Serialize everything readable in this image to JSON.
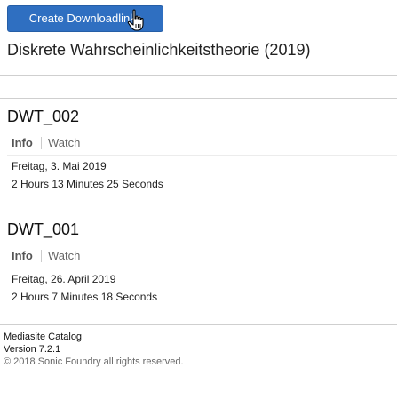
{
  "toolbar": {
    "create_downloadlinks_label": "Create Downloadlinks"
  },
  "catalog": {
    "title": "Diskrete Wahrscheinlichkeitstheorie (2019)"
  },
  "presentations": [
    {
      "title": "DWT_002",
      "tabs": {
        "info": "Info",
        "watch": "Watch"
      },
      "date": "Freitag, 3. Mai 2019",
      "duration": "2 Hours 13 Minutes 25 Seconds"
    },
    {
      "title": "DWT_001",
      "tabs": {
        "info": "Info",
        "watch": "Watch"
      },
      "date": "Freitag, 26. April 2019",
      "duration": "2 Hours 7 Minutes 18 Seconds"
    }
  ],
  "footer": {
    "name": "Mediasite Catalog",
    "version": "Version 7.2.1",
    "copyright": "© 2018 Sonic Foundry all rights reserved."
  },
  "colors": {
    "button_bg": "#2f6fc1",
    "button_text": "#ffffff",
    "divider": "#cfcfcf"
  },
  "icons": {
    "cursor": "hand-pointer-icon"
  }
}
